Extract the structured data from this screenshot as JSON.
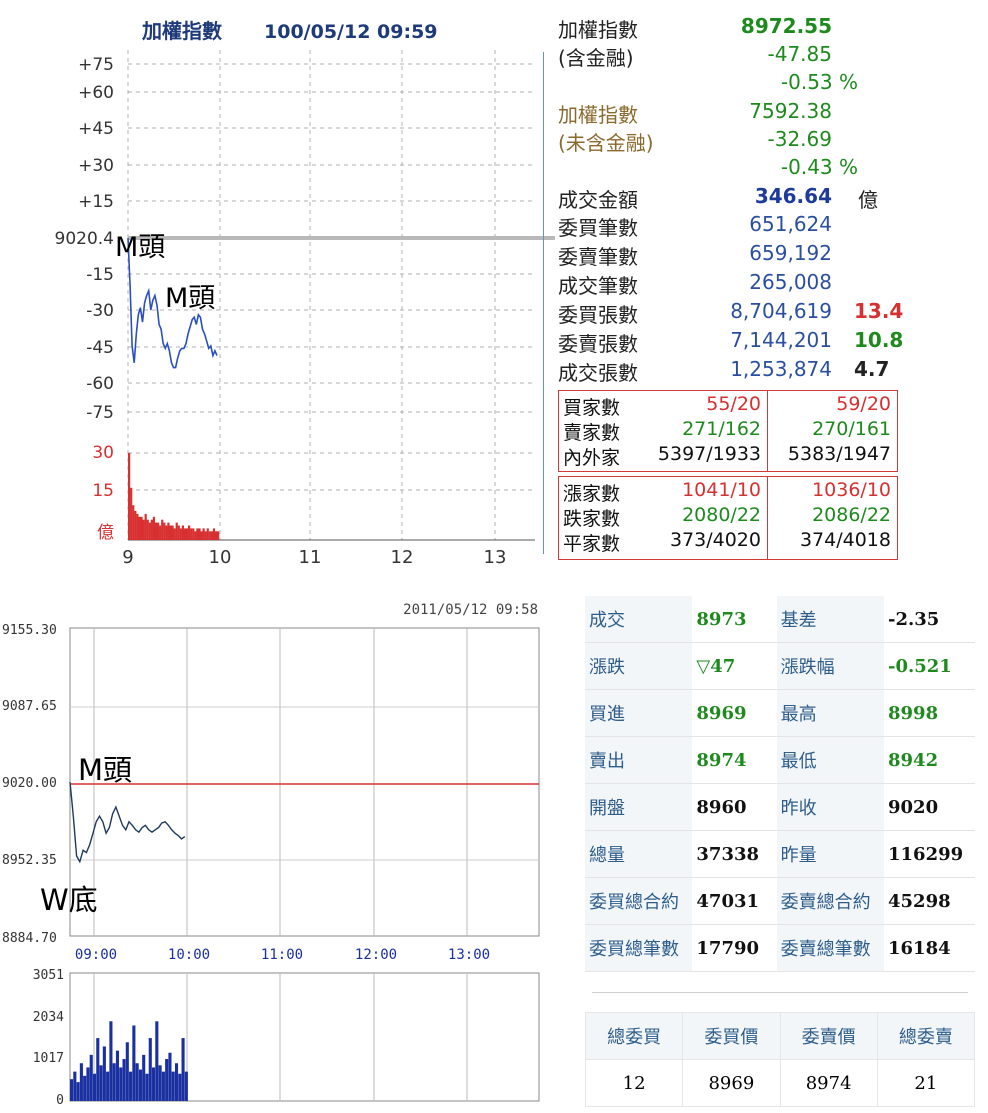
{
  "top_chart": {
    "title": "加權指數",
    "datetime": "100/05/12 09:59",
    "y_labels": [
      "+75",
      "+60",
      "+45",
      "+30",
      "+15",
      "9020.4",
      "-15",
      "-30",
      "-45",
      "-60",
      "-75"
    ],
    "vol_labels": [
      "30",
      "15",
      "億"
    ],
    "x_labels": [
      "9",
      "10",
      "11",
      "12",
      "13"
    ],
    "annotation1": "M頭",
    "annotation2": "M頭",
    "colors": {
      "price_line": "#2b4fbf",
      "volume": "#d83030",
      "grid": "#aaaaaa",
      "ref": "#b8b8b8"
    }
  },
  "info": {
    "tw_label1": "加權指數",
    "tw_label2": "(含金融)",
    "tw_value": "8972.55",
    "tw_change": "-47.85",
    "tw_pct": "-0.53 %",
    "ex_label1": "加權指數",
    "ex_label2": "(未含金融)",
    "ex_value": "7592.38",
    "ex_change": "-32.69",
    "ex_pct": "-0.43 %",
    "amount_label": "成交金額",
    "amount_value": "346.64",
    "amount_unit": "億",
    "rows": [
      {
        "label": "委買筆數",
        "value": "651,624",
        "pct": ""
      },
      {
        "label": "委賣筆數",
        "value": "659,192",
        "pct": ""
      },
      {
        "label": "成交筆數",
        "value": "265,008",
        "pct": ""
      },
      {
        "label": "委買張數",
        "value": "8,704,619",
        "pct": "13.4",
        "pct_color": "#d63030"
      },
      {
        "label": "委賣張數",
        "value": "7,144,201",
        "pct": "10.8",
        "pct_color": "#1e8a1e"
      },
      {
        "label": "成交張數",
        "value": "1,253,874",
        "pct": "4.7",
        "pct_color": "#222222"
      }
    ],
    "box1": [
      {
        "label": "買家數",
        "a": "55/20",
        "b": "59/20",
        "color": "#d63030"
      },
      {
        "label": "賣家數",
        "a": "271/162",
        "b": "270/161",
        "color": "#1e8a1e"
      },
      {
        "label": "內外家",
        "a": "5397/1933",
        "b": "5383/1947",
        "color": "#111111"
      }
    ],
    "box2": [
      {
        "label": "漲家數",
        "a": "1041/10",
        "b": "1036/10",
        "color": "#d63030"
      },
      {
        "label": "跌家數",
        "a": "2080/22",
        "b": "2086/22",
        "color": "#1e8a1e"
      },
      {
        "label": "平家數",
        "a": "373/4020",
        "b": "374/4018",
        "color": "#111111"
      }
    ]
  },
  "bottom_chart": {
    "datetime": "2011/05/12 09:58",
    "y_labels": [
      "9155.30",
      "9087.65",
      "9020.00",
      "8952.35",
      "8884.70"
    ],
    "x_labels": [
      "09:00",
      "10:00",
      "11:00",
      "12:00",
      "13:00"
    ],
    "vol_labels": [
      "3051",
      "2034",
      "1017",
      "0"
    ],
    "annotation_top": "M頭",
    "annotation_bottom": "W底",
    "colors": {
      "price_line": "#1f3a5a",
      "volume": "#1a2fa0",
      "ref": "#d83030"
    }
  },
  "quote": {
    "rows": [
      {
        "k1": "成交",
        "v1": "8973",
        "c1": "#1e8a1e",
        "k2": "基差",
        "v2": "-2.35",
        "c2": "#111111"
      },
      {
        "k1": "漲跌",
        "v1": "▽47",
        "c1": "#1e8a1e",
        "k2": "漲跌幅",
        "v2": "-0.521",
        "c2": "#1e8a1e"
      },
      {
        "k1": "買進",
        "v1": "8969",
        "c1": "#1e8a1e",
        "k2": "最高",
        "v2": "8998",
        "c2": "#1e8a1e"
      },
      {
        "k1": "賣出",
        "v1": "8974",
        "c1": "#1e8a1e",
        "k2": "最低",
        "v2": "8942",
        "c2": "#1e8a1e"
      },
      {
        "k1": "開盤",
        "v1": "8960",
        "c1": "#111111",
        "k2": "昨收",
        "v2": "9020",
        "c2": "#111111"
      },
      {
        "k1": "總量",
        "v1": "37338",
        "c1": "#111111",
        "k2": "昨量",
        "v2": "116299",
        "c2": "#111111"
      },
      {
        "k1": "委買總合約",
        "v1": "47031",
        "c1": "#111111",
        "k2": "委賣總合約",
        "v2": "45298",
        "c2": "#111111"
      },
      {
        "k1": "委買總筆數",
        "v1": "17790",
        "c1": "#111111",
        "k2": "委賣總筆數",
        "v2": "16184",
        "c2": "#111111"
      }
    ],
    "book_headers": [
      "總委買",
      "委買價",
      "委賣價",
      "總委賣"
    ],
    "book_values": [
      "12",
      "8969",
      "8974",
      "21"
    ]
  }
}
